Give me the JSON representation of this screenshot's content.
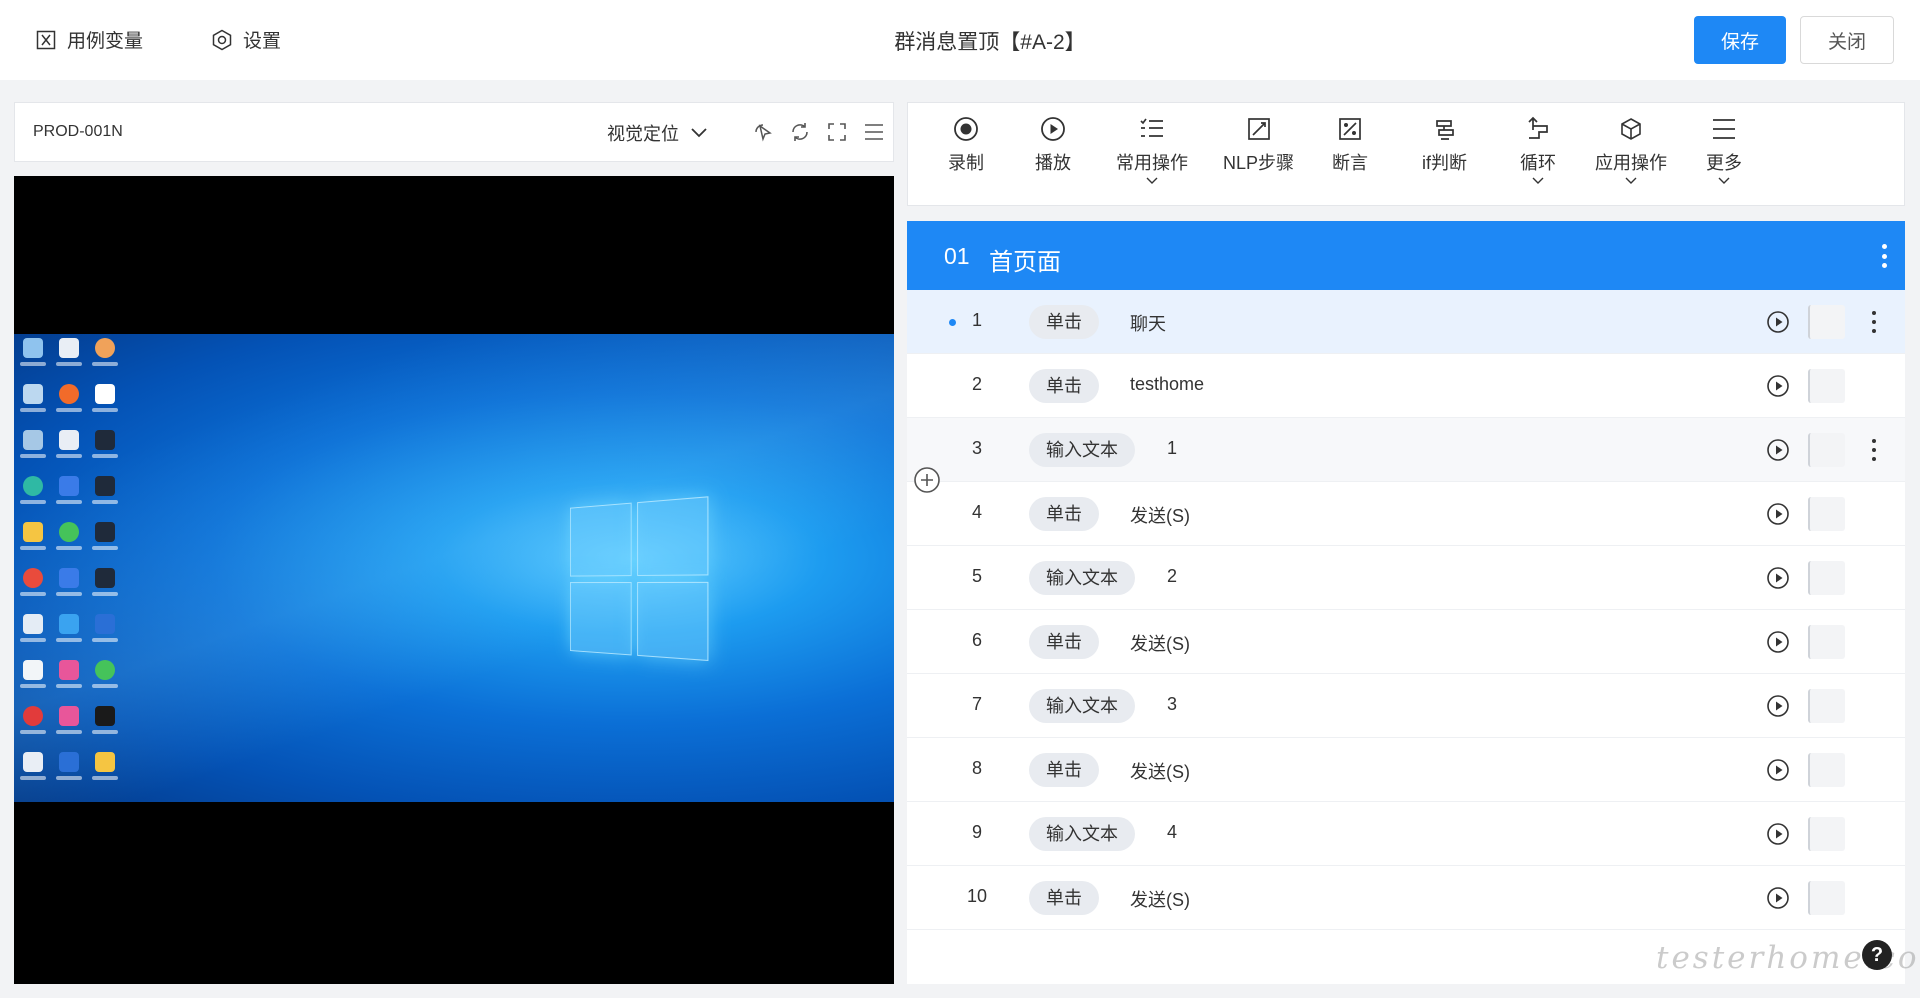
{
  "topbar": {
    "variables_label": "用例变量",
    "settings_label": "设置",
    "title": "群消息置顶【#A-2】",
    "save_label": "保存",
    "close_label": "关闭"
  },
  "device": {
    "name": "PROD-001N",
    "locate_mode": "视觉定位"
  },
  "toolbar": {
    "items": [
      {
        "label": "录制",
        "icon": "record-icon",
        "dropdown": false
      },
      {
        "label": "播放",
        "icon": "play-icon",
        "dropdown": false
      },
      {
        "label": "常用操作",
        "icon": "list-icon",
        "dropdown": true
      },
      {
        "label": "NLP步骤",
        "icon": "nlp-icon",
        "dropdown": false
      },
      {
        "label": "断言",
        "icon": "assert-icon",
        "dropdown": false
      },
      {
        "label": "if判断",
        "icon": "if-icon",
        "dropdown": false
      },
      {
        "label": "循环",
        "icon": "loop-icon",
        "dropdown": true
      },
      {
        "label": "应用操作",
        "icon": "cube-icon",
        "dropdown": true
      },
      {
        "label": "更多",
        "icon": "menu-icon",
        "dropdown": true
      }
    ]
  },
  "group": {
    "number": "01",
    "name": "首页面"
  },
  "steps": [
    {
      "num": "1",
      "action": "单击",
      "target": "聊天"
    },
    {
      "num": "2",
      "action": "单击",
      "target": "testhome"
    },
    {
      "num": "3",
      "action": "输入文本",
      "target": "1"
    },
    {
      "num": "4",
      "action": "单击",
      "target": "发送(S)"
    },
    {
      "num": "5",
      "action": "输入文本",
      "target": "2"
    },
    {
      "num": "6",
      "action": "单击",
      "target": "发送(S)"
    },
    {
      "num": "7",
      "action": "输入文本",
      "target": "3"
    },
    {
      "num": "8",
      "action": "单击",
      "target": "发送(S)"
    },
    {
      "num": "9",
      "action": "输入文本",
      "target": "4"
    },
    {
      "num": "10",
      "action": "单击",
      "target": "发送(S)"
    }
  ],
  "help_label": "?",
  "watermark": "testerhome.com",
  "colors": {
    "accent": "#1e88f5",
    "selected_row": "#e9f2fe",
    "tag_bg": "#e8ebf0"
  }
}
